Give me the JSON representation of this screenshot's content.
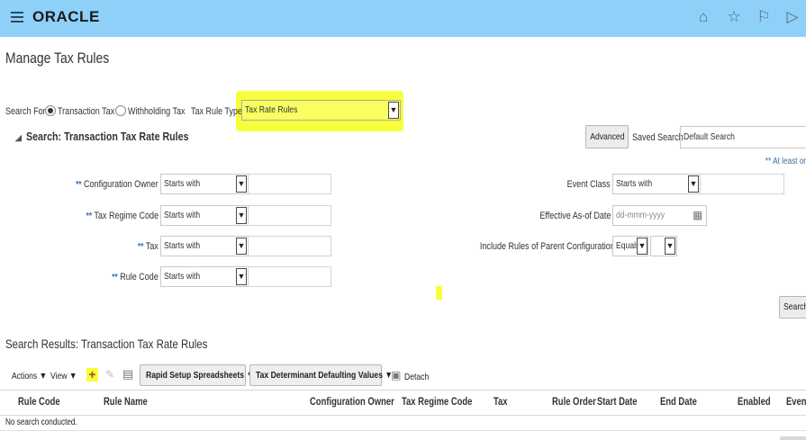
{
  "header": {
    "logo": "ORACLE",
    "icons": [
      "home-icon",
      "star-icon",
      "flag-icon",
      "signout-icon"
    ]
  },
  "page": {
    "title": "Manage Tax Rules"
  },
  "search_for": {
    "label": "Search For",
    "option_transaction": "Transaction Tax",
    "option_withholding": "Withholding Tax",
    "selected": "Transaction Tax",
    "rule_type_label": "Tax Rule Type",
    "rule_type_value": "Tax Rate Rules"
  },
  "search_panel": {
    "title": "Search: Transaction Tax Rate Rules",
    "advanced": "Advanced",
    "saved_search_label": "Saved Search",
    "saved_search_value": "Default Search",
    "at_least_note": "** At least or",
    "required_marker": "**",
    "fields_left": [
      {
        "label": "Configuration Owner",
        "operator": "Starts with"
      },
      {
        "label": "Tax Regime Code",
        "operator": "Starts with"
      },
      {
        "label": "Tax",
        "operator": "Starts with"
      },
      {
        "label": "Rule Code",
        "operator": "Starts with"
      }
    ],
    "event_class": {
      "label": "Event Class",
      "operator": "Starts with"
    },
    "effective_as_of": {
      "label": "Effective As-of Date",
      "placeholder": "dd-mmm-yyyy"
    },
    "include_parent": {
      "label": "Include Rules of Parent Configuration",
      "operator": "Equals"
    },
    "search_button": "Search"
  },
  "results": {
    "title": "Search Results: Transaction Tax Rate Rules",
    "toolbar": {
      "actions": "Actions ▼",
      "view": "View ▼",
      "rapid_setup": "Rapid Setup Spreadsheets ▼",
      "tax_determinant": "Tax Determinant Defaulting Values ▼",
      "detach": "Detach"
    },
    "columns": [
      "Rule Code",
      "Rule Name",
      "Configuration Owner",
      "Tax Regime Code",
      "Tax",
      "Rule Order",
      "Start Date",
      "End Date",
      "Enabled",
      "Even"
    ],
    "empty_message": "No search conducted."
  },
  "colors": {
    "header_bg": "#8ed0f8",
    "highlight": "#f7ff3c",
    "link": "#2f6ca8"
  }
}
